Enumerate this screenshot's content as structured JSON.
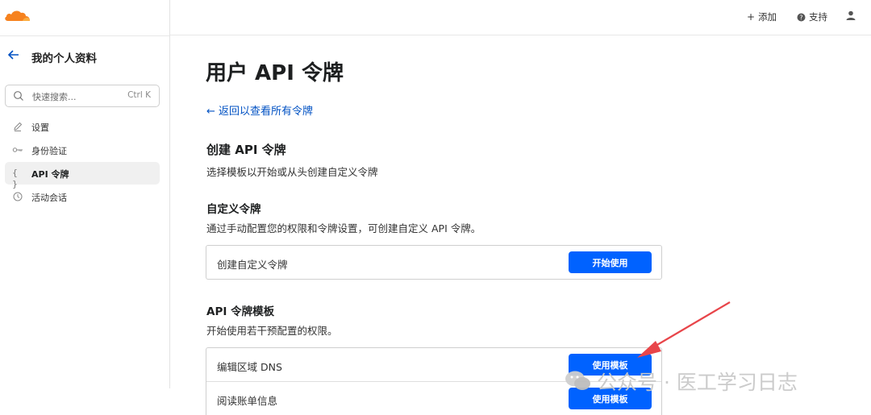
{
  "sidebar": {
    "title": "我的个人资料",
    "search": {
      "placeholder": "快速搜索...",
      "shortcut": "Ctrl K"
    },
    "items": [
      {
        "label": "设置",
        "icon": "pencil-icon"
      },
      {
        "label": "身份验证",
        "icon": "key-icon"
      },
      {
        "label": "API 令牌",
        "icon": "braces-icon",
        "active": true
      },
      {
        "label": "活动会话",
        "icon": "clock-icon"
      }
    ]
  },
  "topbar": {
    "add_label": "添加",
    "support_label": "支持"
  },
  "main": {
    "title": "用户 API 令牌",
    "back_link": "← 返回以查看所有令牌",
    "create": {
      "title": "创建 API 令牌",
      "subtitle": "选择模板以开始或从头创建自定义令牌"
    },
    "custom": {
      "title": "自定义令牌",
      "subtitle": "通过手动配置您的权限和令牌设置，可创建自定义 API 令牌。",
      "row_label": "创建自定义令牌",
      "button": "开始使用"
    },
    "templates": {
      "title": "API 令牌模板",
      "subtitle": "开始使用若干预配置的权限。",
      "rows": [
        {
          "label": "编辑区域 DNS",
          "button": "使用模板"
        },
        {
          "label": "阅读账单信息",
          "button": "使用模板"
        }
      ]
    }
  },
  "watermark": {
    "text": "公众号 · 医工学习日志"
  },
  "colors": {
    "accent": "#0062ff",
    "link": "#0051c3",
    "brand_orange": "#f6821f",
    "annotation_red": "#e8454a"
  }
}
